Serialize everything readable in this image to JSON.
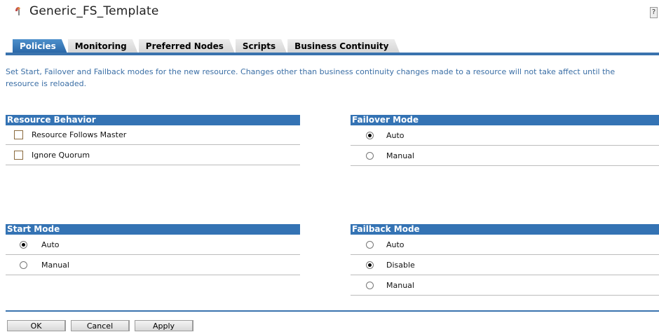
{
  "window": {
    "title": "Generic_FS_Template",
    "help_label": "?",
    "icon": "resource-icon"
  },
  "tabs": [
    {
      "label": "Policies",
      "active": true
    },
    {
      "label": "Monitoring",
      "active": false
    },
    {
      "label": "Preferred Nodes",
      "active": false
    },
    {
      "label": "Scripts",
      "active": false
    },
    {
      "label": "Business Continuity",
      "active": false
    }
  ],
  "description": "Set Start, Failover and Failback modes for the new resource. Changes other than business continuity changes made to a resource will not take affect until the resource is reloaded.",
  "resource_behavior": {
    "header": "Resource Behavior",
    "items": [
      {
        "label": "Resource Follows Master",
        "checked": false
      },
      {
        "label": "Ignore Quorum",
        "checked": false
      }
    ]
  },
  "failover_mode": {
    "header": "Failover Mode",
    "options": [
      {
        "label": "Auto",
        "selected": true
      },
      {
        "label": "Manual",
        "selected": false
      }
    ]
  },
  "start_mode": {
    "header": "Start Mode",
    "options": [
      {
        "label": "Auto",
        "selected": true
      },
      {
        "label": "Manual",
        "selected": false
      }
    ]
  },
  "failback_mode": {
    "header": "Failback Mode",
    "options": [
      {
        "label": "Auto",
        "selected": false
      },
      {
        "label": "Disable",
        "selected": true
      },
      {
        "label": "Manual",
        "selected": false
      }
    ]
  },
  "buttons": {
    "ok": "OK",
    "cancel": "Cancel",
    "apply": "Apply"
  },
  "colors": {
    "accent": "#3473b4",
    "description_text": "#3a6ea5"
  }
}
